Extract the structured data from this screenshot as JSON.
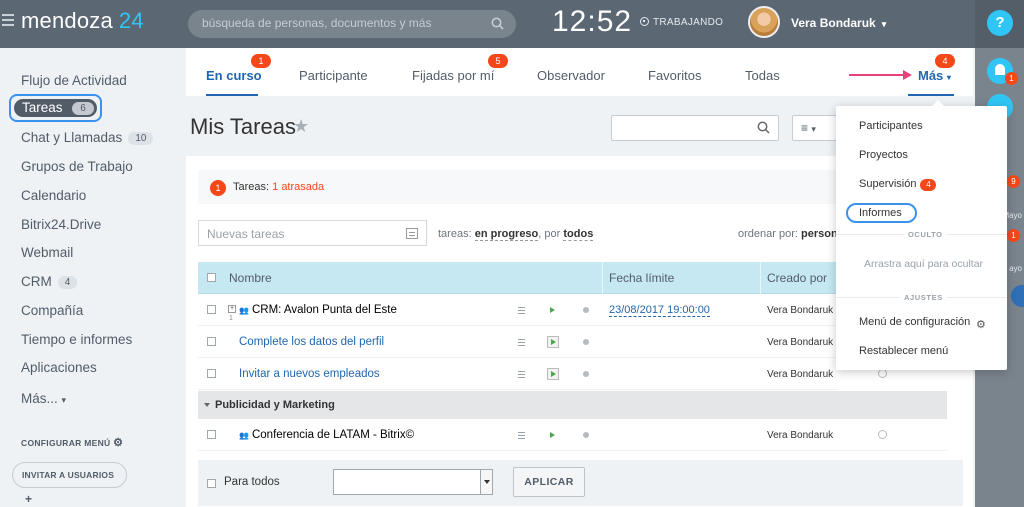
{
  "header": {
    "logo_name": "mendoza",
    "logo_num": "24",
    "search_placeholder": "búsqueda de personas, documentos y más",
    "clock": "12:52",
    "work_status": "TRABAJANDO",
    "user_name": "Vera Bondaruk"
  },
  "right_rail": {
    "help": "?",
    "bell_badge": "1",
    "item1_badge": "9",
    "item1_label": "Mayo",
    "item2_badge": "1",
    "item2_label": "ayo"
  },
  "sidebar": {
    "items": [
      {
        "label": "Flujo de Actividad"
      },
      {
        "label": "Tareas",
        "count": "6"
      },
      {
        "label": "Chat y Llamadas",
        "count": "10"
      },
      {
        "label": "Grupos de Trabajo"
      },
      {
        "label": "Calendario"
      },
      {
        "label": "Bitrix24.Drive"
      },
      {
        "label": "Webmail"
      },
      {
        "label": "CRM",
        "count": "4"
      },
      {
        "label": "Compañía"
      },
      {
        "label": "Tiempo e informes"
      },
      {
        "label": "Aplicaciones"
      },
      {
        "label": "Más..."
      }
    ],
    "configure": "CONFIGURAR MENÚ",
    "invite": "INVITAR A USUARIOS"
  },
  "tabs": [
    {
      "label": "En curso",
      "badge": "1"
    },
    {
      "label": "Participante"
    },
    {
      "label": "Fijadas por mí",
      "badge": "5"
    },
    {
      "label": "Observador"
    },
    {
      "label": "Favoritos"
    },
    {
      "label": "Todas"
    }
  ],
  "more_tab": {
    "label": "Más",
    "badge": "4"
  },
  "page": {
    "title": "Mis Tareas",
    "alert_badge": "1",
    "alert_prefix": "Tareas:",
    "alert_link": "1 atrasada",
    "new_task_placeholder": "Nuevas tareas",
    "filter_prefix": "tareas:",
    "filter_status": "en progreso",
    "filter_sep": "por",
    "filter_who": "todos",
    "order_prefix": "ordenar por:",
    "order_value": "persona"
  },
  "table": {
    "columns": [
      "Nombre",
      "Fecha límite",
      "Creado por"
    ],
    "rows": [
      {
        "name": "CRM: Avalon Punta del Este",
        "sub": "1",
        "deadline": "23/08/2017 19:00:00",
        "created_by": "Vera Bondaruk"
      },
      {
        "name": "Complete los datos del perfil",
        "created_by": "Vera Bondaruk"
      },
      {
        "name": "Invitar a nuevos empleados",
        "created_by": "Vera Bondaruk"
      }
    ],
    "group": "Publicidad y Marketing",
    "group_rows": [
      {
        "name": "Conferencia de LATAM - Bitrix©",
        "created_by": "Vera Bondaruk"
      }
    ]
  },
  "footer": {
    "all_label": "Para todos",
    "apply": "APLICAR"
  },
  "popup": {
    "items": [
      "Participantes",
      "Proyectos",
      "Supervisión",
      "Informes"
    ],
    "supervision_badge": "4",
    "hidden_header": "OCULTO",
    "drag_hint": "Arrastra aquí para ocultar",
    "settings_header": "AJUSTES",
    "menu_config": "Menú de configuración",
    "reset": "Restablecer menú"
  }
}
